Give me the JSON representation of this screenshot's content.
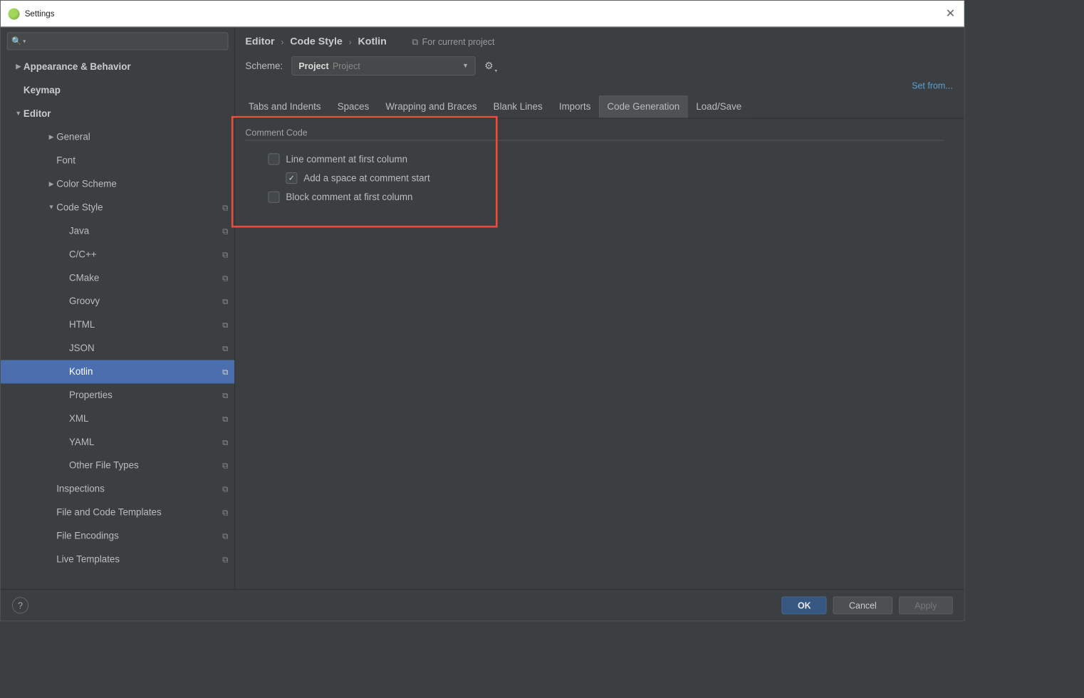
{
  "window": {
    "title": "Settings"
  },
  "sidebar": {
    "items": [
      {
        "label": "Appearance & Behavior",
        "bold": true,
        "arrow": "▶",
        "indent": 0
      },
      {
        "label": "Keymap",
        "bold": true,
        "arrow": "",
        "indent": 0
      },
      {
        "label": "Editor",
        "bold": true,
        "arrow": "▼",
        "indent": 0
      },
      {
        "label": "General",
        "arrow": "▶",
        "indent": 2
      },
      {
        "label": "Font",
        "arrow": "",
        "indent": 2
      },
      {
        "label": "Color Scheme",
        "arrow": "▶",
        "indent": 2
      },
      {
        "label": "Code Style",
        "arrow": "▼",
        "indent": 2,
        "copy": true
      },
      {
        "label": "Java",
        "indent": 3,
        "copy": true
      },
      {
        "label": "C/C++",
        "indent": 3,
        "copy": true
      },
      {
        "label": "CMake",
        "indent": 3,
        "copy": true
      },
      {
        "label": "Groovy",
        "indent": 3,
        "copy": true
      },
      {
        "label": "HTML",
        "indent": 3,
        "copy": true
      },
      {
        "label": "JSON",
        "indent": 3,
        "copy": true
      },
      {
        "label": "Kotlin",
        "indent": 3,
        "copy": true,
        "selected": true
      },
      {
        "label": "Properties",
        "indent": 3,
        "copy": true
      },
      {
        "label": "XML",
        "indent": 3,
        "copy": true
      },
      {
        "label": "YAML",
        "indent": 3,
        "copy": true
      },
      {
        "label": "Other File Types",
        "indent": 3,
        "copy": true
      },
      {
        "label": "Inspections",
        "indent": 2,
        "copy": true
      },
      {
        "label": "File and Code Templates",
        "indent": 2,
        "copy": true
      },
      {
        "label": "File Encodings",
        "indent": 2,
        "copy": true
      },
      {
        "label": "Live Templates",
        "indent": 2,
        "copy": true
      }
    ]
  },
  "breadcrumb": {
    "items": [
      "Editor",
      "Code Style",
      "Kotlin"
    ],
    "scope": "For current project"
  },
  "scheme": {
    "label": "Scheme:",
    "value": "Project",
    "sub": "Project"
  },
  "setfrom": "Set from...",
  "tabs": [
    "Tabs and Indents",
    "Spaces",
    "Wrapping and Braces",
    "Blank Lines",
    "Imports",
    "Code Generation",
    "Load/Save"
  ],
  "activeTab": "Code Generation",
  "section": {
    "title": "Comment Code",
    "options": [
      {
        "label": "Line comment at first column",
        "checked": false,
        "nested": false
      },
      {
        "label": "Add a space at comment start",
        "checked": true,
        "nested": true
      },
      {
        "label": "Block comment at first column",
        "checked": false,
        "nested": false
      }
    ]
  },
  "footer": {
    "ok": "OK",
    "cancel": "Cancel",
    "apply": "Apply"
  }
}
